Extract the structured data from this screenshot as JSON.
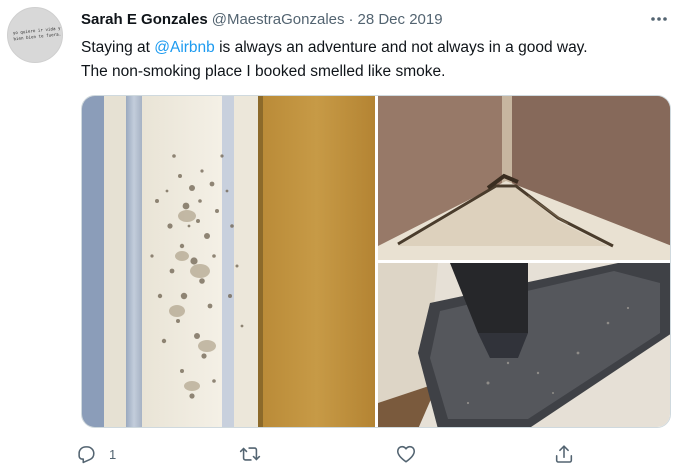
{
  "tweet": {
    "author_name": "Sarah E Gonzales",
    "handle": "@MaestraGonzales",
    "separator": "·",
    "date": "28 Dec 2019",
    "avatar_text": "yo quiero ir vida y\nbien bien te fuera...\n",
    "text_line1_before": "Staying at ",
    "mention": "@Airbnb",
    "text_line1_after": " is always an adventure and not always in a good way.",
    "text_line2": "The non-smoking place I booked smelled like smoke."
  },
  "actions": {
    "reply_count": "1"
  },
  "icons": {
    "more": "more-horizontal-icon",
    "reply": "reply-icon",
    "retweet": "retweet-icon",
    "like": "heart-icon",
    "share": "share-icon"
  },
  "colors": {
    "text": "#0f1419",
    "secondary": "#536471",
    "link": "#1d9bf0",
    "border": "#cfd9de"
  }
}
